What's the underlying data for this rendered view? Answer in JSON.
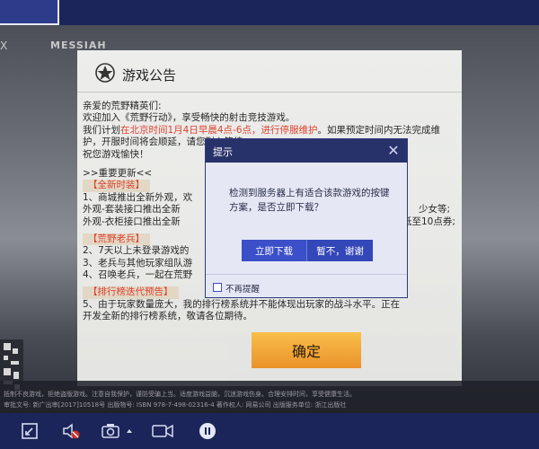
{
  "game": {
    "logo_left": "X",
    "logo_brand": "MESSIAH"
  },
  "announcement": {
    "title": "游戏公告",
    "lines": [
      "亲爱的荒野精英们:",
      "    欢迎加入《荒野行动》，享受畅快的射击竞技游戏。",
      "    我们计划",
      "在北京时间1月4日早晨4点-6点，进行停服维护",
      "。如果预定时间内无法完成维",
      "护，开服时间将会顺延，",
      "请您耐心等待。",
      "    祝您游戏愉快！",
      ">>重要更新<<",
      "【全新时装】",
      "1、商城推出全新外观，欢",
      "   外观-套装接口推出全新",
      "少女等;",
      "   外观-衣柜接口推出全新",
      "低至10点券;",
      "【荒野老兵】",
      "2、7天以上未登录游戏的",
      "3、老兵与其他玩家组队游",
      "4、召唤老兵，一起在荒野",
      "【排行榜迭代预告】",
      "5、由于玩家数量庞大，我",
      "的排行榜系统并不能体现出玩家的战斗水平。正在",
      "开发全新的排行榜系统，敬请各位期待。"
    ],
    "confirm_label": "确定"
  },
  "footer": {
    "line1": "抵制不良游戏，拒绝盗版游戏。注意自我保护，谨防受骗上当。适度游戏益脑，沉迷游戏伤身。合理安排时间，享受健康生活。",
    "line2": "审批文号: 新广出审[2017]10518号   出版物号: ISBN 978-7-498-02316-4   著作权人: 网易公司   出版服务单位: 浙江出版社"
  },
  "dialog": {
    "title": "提示",
    "close_label": "✕",
    "message": "检测到服务器上有适合该款游戏的按键方案，是否立即下载？",
    "download_label": "立即下载",
    "decline_label": "暂不，谢谢",
    "checkbox_label": "不再提醒",
    "accent_color": "#3b4fc8"
  },
  "toolbar": {
    "icons": [
      "fullscreen-icon",
      "mute-icon",
      "screenshot-icon",
      "record-icon",
      "pause-icon"
    ]
  }
}
